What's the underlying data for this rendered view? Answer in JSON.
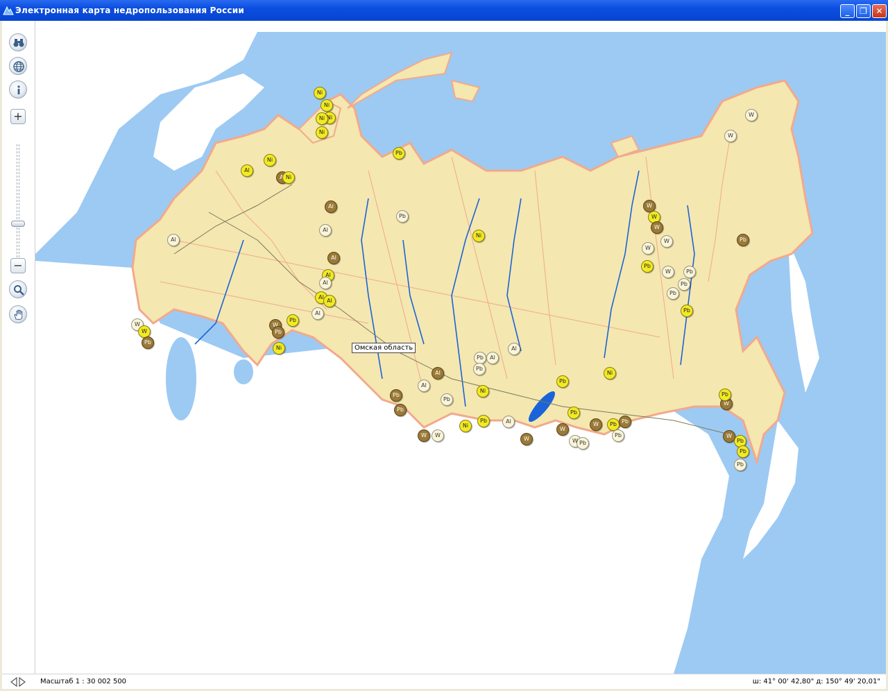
{
  "window": {
    "title": "Электронная карта недропользования России"
  },
  "toolbar": {
    "tools": [
      {
        "name": "binoculars-button",
        "icon": "binoculars-icon"
      },
      {
        "name": "globe-button",
        "icon": "globe-icon"
      },
      {
        "name": "info-button",
        "icon": "info-icon"
      },
      {
        "name": "search-button",
        "icon": "magnifier-icon"
      },
      {
        "name": "pan-button",
        "icon": "hand-icon"
      }
    ],
    "zoom_in_label": "+",
    "zoom_out_label": "−",
    "zoom_level_fraction": 0.68
  },
  "map": {
    "tooltip": "Омская область",
    "colors": {
      "sea": "#9ccaf3",
      "russia_fill": "#f4e7b0",
      "russia_border": "#f2a98c",
      "foreign_land": "#ffffff",
      "river": "#1b63d8",
      "yellow_marker": "#f2ea24",
      "brown_marker": "#9b7a37",
      "cream_marker": "#faf5d8"
    },
    "marker_labels": [
      "Ni",
      "Al",
      "Pb",
      "W"
    ]
  },
  "statusbar": {
    "scale": "Масштаб 1 : 30 002 500",
    "coordinates": "ш: 41° 00' 42,80\" д: 150° 49' 20,01\""
  }
}
